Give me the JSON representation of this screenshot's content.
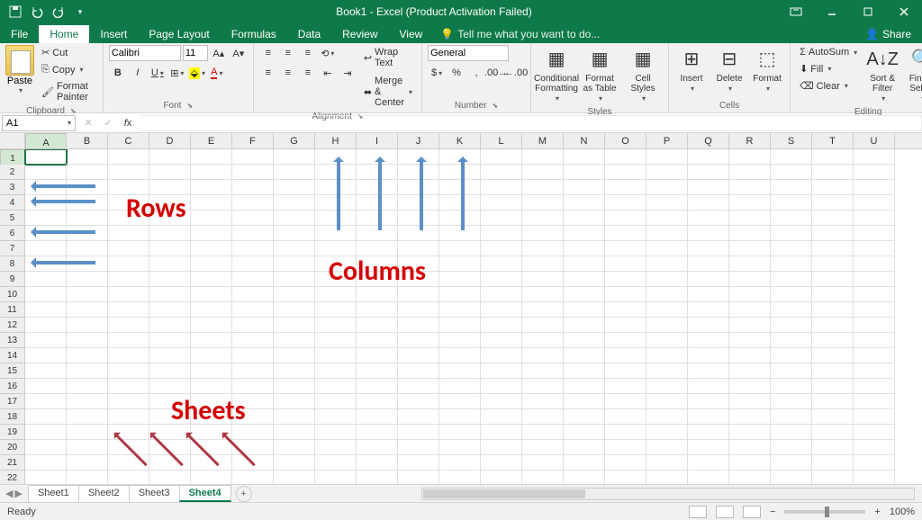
{
  "title": "Book1 - Excel (Product Activation Failed)",
  "tabs": {
    "file": "File",
    "home": "Home",
    "insert": "Insert",
    "pagelayout": "Page Layout",
    "formulas": "Formulas",
    "data": "Data",
    "review": "Review",
    "view": "View",
    "tellme": "Tell me what you want to do...",
    "share": "Share"
  },
  "clipboard": {
    "cut": "Cut",
    "copy": "Copy",
    "formatpainter": "Format Painter",
    "paste": "Paste",
    "label": "Clipboard"
  },
  "font": {
    "name": "Calibri",
    "size": "11",
    "label": "Font"
  },
  "alignment": {
    "wrap": "Wrap Text",
    "merge": "Merge & Center",
    "label": "Alignment"
  },
  "number": {
    "format": "General",
    "label": "Number"
  },
  "styles": {
    "cond": "Conditional Formatting",
    "table": "Format as Table",
    "cell": "Cell Styles",
    "label": "Styles"
  },
  "cells": {
    "insert": "Insert",
    "delete": "Delete",
    "format": "Format",
    "label": "Cells"
  },
  "editing": {
    "autosum": "AutoSum",
    "fill": "Fill",
    "clear": "Clear",
    "sort": "Sort & Filter",
    "find": "Find & Select",
    "label": "Editing"
  },
  "namebox": "A1",
  "columns": [
    "A",
    "B",
    "C",
    "D",
    "E",
    "F",
    "G",
    "H",
    "I",
    "J",
    "K",
    "L",
    "M",
    "N",
    "O",
    "P",
    "Q",
    "R",
    "S",
    "T",
    "U"
  ],
  "rowcount": 23,
  "annotations": {
    "rows": "Rows",
    "columns": "Columns",
    "sheets": "Sheets"
  },
  "sheets": [
    "Sheet1",
    "Sheet2",
    "Sheet3",
    "Sheet4"
  ],
  "active_sheet": "Sheet4",
  "status": "Ready",
  "zoom": "100%"
}
